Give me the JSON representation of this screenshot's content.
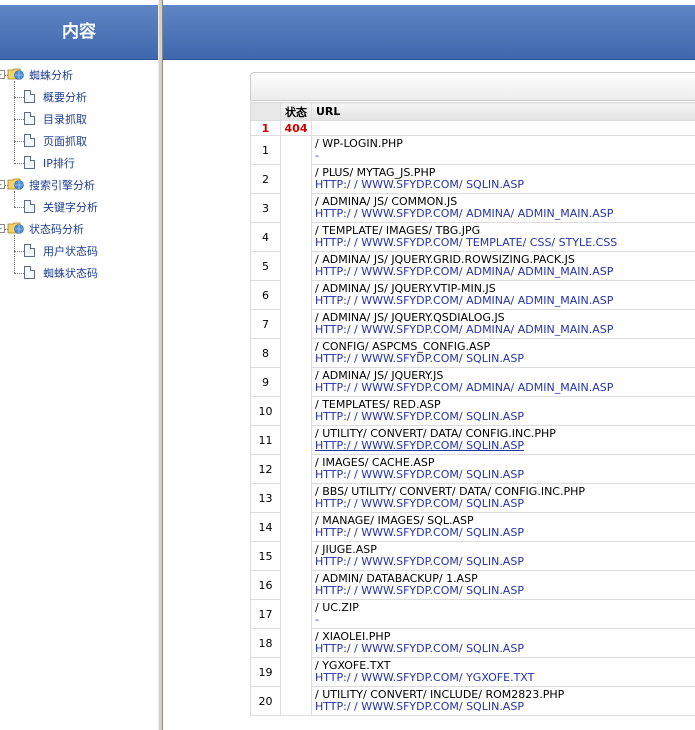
{
  "sidebar": {
    "title": "内容",
    "tree": [
      {
        "label": "蜘蛛分析",
        "children": [
          "概要分析",
          "目录抓取",
          "页面抓取",
          "IP排行"
        ]
      },
      {
        "label": "搜索引擎分析",
        "children": [
          "关键字分析"
        ]
      },
      {
        "label": "状态码分析",
        "children": [
          "用户状态码",
          "蜘蛛状态码"
        ]
      }
    ]
  },
  "table": {
    "headers": {
      "index": "",
      "status": "状态",
      "url": "URL"
    },
    "error_row": {
      "index": "1",
      "status": "404",
      "url": ""
    },
    "rows": [
      {
        "index": "1",
        "path": "/ WP-LOGIN.PHP",
        "referrer": "-"
      },
      {
        "index": "2",
        "path": "/ PLUS/ MYTAG_JS.PHP",
        "referrer": "HTTP:/ / WWW.SFYDP.COM/ SQLIN.ASP"
      },
      {
        "index": "3",
        "path": "/ ADMINA/ JS/ COMMON.JS",
        "referrer": "HTTP:/ / WWW.SFYDP.COM/ ADMINA/ ADMIN_MAIN.ASP"
      },
      {
        "index": "4",
        "path": "/ TEMPLATE/ IMAGES/ TBG.JPG",
        "referrer": "HTTP:/ / WWW.SFYDP.COM/ TEMPLATE/ CSS/ STYLE.CSS"
      },
      {
        "index": "5",
        "path": "/ ADMINA/ JS/ JQUERY.GRID.ROWSIZING.PACK.JS",
        "referrer": "HTTP:/ / WWW.SFYDP.COM/ ADMINA/ ADMIN_MAIN.ASP"
      },
      {
        "index": "6",
        "path": "/ ADMINA/ JS/ JQUERY.VTIP-MIN.JS",
        "referrer": "HTTP:/ / WWW.SFYDP.COM/ ADMINA/ ADMIN_MAIN.ASP"
      },
      {
        "index": "7",
        "path": "/ ADMINA/ JS/ JQUERY.QSDIALOG.JS",
        "referrer": "HTTP:/ / WWW.SFYDP.COM/ ADMINA/ ADMIN_MAIN.ASP"
      },
      {
        "index": "8",
        "path": "/ CONFIG/ ASPCMS_CONFIG.ASP",
        "referrer": "HTTP:/ / WWW.SFYDP.COM/ SQLIN.ASP"
      },
      {
        "index": "9",
        "path": "/ ADMINA/ JS/ JQUERY.JS",
        "referrer": "HTTP:/ / WWW.SFYDP.COM/ ADMINA/ ADMIN_MAIN.ASP"
      },
      {
        "index": "10",
        "path": "/ TEMPLATES/ RED.ASP",
        "referrer": "HTTP:/ / WWW.SFYDP.COM/ SQLIN.ASP"
      },
      {
        "index": "11",
        "path": "/ UTILITY/ CONVERT/ DATA/ CONFIG.INC.PHP",
        "referrer": "HTTP:/ / WWW.SFYDP.COM/ SQLIN.ASP"
      },
      {
        "index": "12",
        "path": "/ IMAGES/ CACHE.ASP",
        "referrer": "HTTP:/ / WWW.SFYDP.COM/ SQLIN.ASP"
      },
      {
        "index": "13",
        "path": "/ BBS/ UTILITY/ CONVERT/ DATA/ CONFIG.INC.PHP",
        "referrer": "HTTP:/ / WWW.SFYDP.COM/ SQLIN.ASP"
      },
      {
        "index": "14",
        "path": "/ MANAGE/ IMAGES/ SQL.ASP",
        "referrer": "HTTP:/ / WWW.SFYDP.COM/ SQLIN.ASP"
      },
      {
        "index": "15",
        "path": "/ JIUGE.ASP",
        "referrer": "HTTP:/ / WWW.SFYDP.COM/ SQLIN.ASP"
      },
      {
        "index": "16",
        "path": "/ ADMIN/ DATABACKUP/ 1.ASP",
        "referrer": "HTTP:/ / WWW.SFYDP.COM/ SQLIN.ASP"
      },
      {
        "index": "17",
        "path": "/ UC.ZIP",
        "referrer": "-"
      },
      {
        "index": "18",
        "path": "/ XIAOLEI.PHP",
        "referrer": "HTTP:/ / WWW.SFYDP.COM/ SQLIN.ASP"
      },
      {
        "index": "19",
        "path": "/ YGXOFE.TXT",
        "referrer": "HTTP:/ / WWW.SFYDP.COM/ YGXOFE.TXT"
      },
      {
        "index": "20",
        "path": "/ UTILITY/ CONVERT/ INCLUDE/ ROM2823.PHP",
        "referrer": "HTTP:/ / WWW.SFYDP.COM/ SQLIN.ASP"
      }
    ]
  },
  "colors": {
    "header_blue": "#4a72b6",
    "link_blue": "#2433a8",
    "error_red": "#d00000",
    "tree_text": "#1d3e8f"
  },
  "icons": {
    "folder": "folder-globe-icon",
    "page": "page-icon",
    "expander": "tree-expander-icon"
  }
}
